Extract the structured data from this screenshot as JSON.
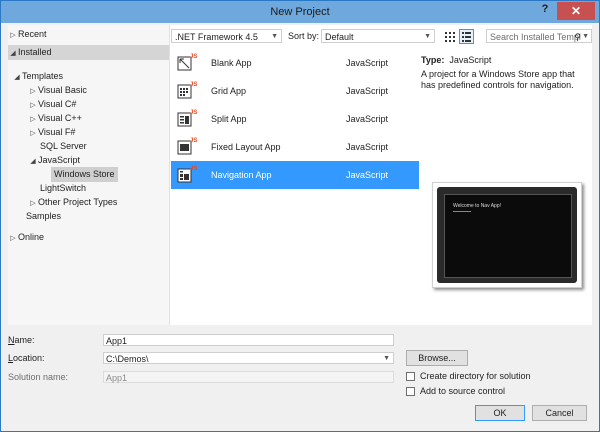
{
  "window": {
    "title": "New Project",
    "help": "?",
    "close": "✕"
  },
  "tree": {
    "recent": "Recent",
    "installed": "Installed",
    "templates": "Templates",
    "visual_basic": "Visual Basic",
    "visual_csharp": "Visual C#",
    "visual_cpp": "Visual C++",
    "visual_fsharp": "Visual F#",
    "sql_server": "SQL Server",
    "javascript": "JavaScript",
    "windows_store": "Windows Store",
    "lightswitch": "LightSwitch",
    "other_project_types": "Other Project Types",
    "samples": "Samples",
    "online": "Online"
  },
  "toolbar": {
    "framework": ".NET Framework 4.5",
    "sort_label": "Sort by:",
    "sort_value": "Default",
    "search_placeholder": "Search Installed Templ"
  },
  "templates": [
    {
      "name": "Blank App",
      "language": "JavaScript",
      "icon": "blank-app-icon"
    },
    {
      "name": "Grid App",
      "language": "JavaScript",
      "icon": "grid-app-icon"
    },
    {
      "name": "Split App",
      "language": "JavaScript",
      "icon": "split-app-icon"
    },
    {
      "name": "Fixed Layout App",
      "language": "JavaScript",
      "icon": "fixed-layout-app-icon"
    },
    {
      "name": "Navigation App",
      "language": "JavaScript",
      "icon": "navigation-app-icon"
    }
  ],
  "details": {
    "type_label": "Type:",
    "type_value": "JavaScript",
    "description": "A project for a Windows Store app that has predefined controls for navigation.",
    "preview_text": "Welcome to Nav App!"
  },
  "form": {
    "name_label": "Name:",
    "name_value": "App1",
    "location_label": "Location:",
    "location_value": "C:\\Demos\\",
    "solution_label": "Solution name:",
    "solution_value": "App1",
    "browse": "Browse...",
    "create_dir": "Create directory for solution",
    "add_source": "Add to source control",
    "ok": "OK",
    "cancel": "Cancel"
  },
  "colors": {
    "selection": "#3399ff",
    "titlebar": "#6ea8dc",
    "close": "#c75050",
    "js_badge": "#e8491f"
  }
}
